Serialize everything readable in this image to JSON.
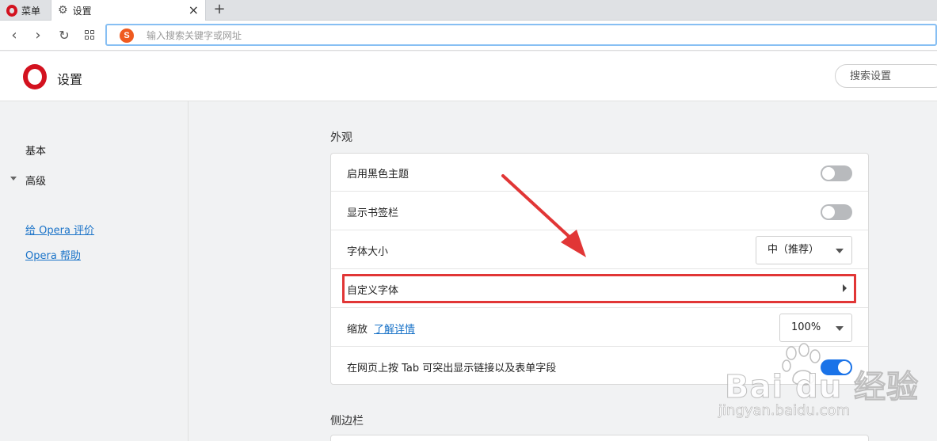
{
  "tabbar": {
    "menu_label": "菜单",
    "tab_title": "设置",
    "close_glyph": "×",
    "new_tab_glyph": "+"
  },
  "navbar": {
    "back_glyph": "‹",
    "forward_glyph": "›",
    "reload_glyph": "↻",
    "search_engine_letter": "S",
    "url_placeholder": "输入搜索关键字或网址",
    "url_value": ""
  },
  "header": {
    "title": "设置",
    "search_placeholder": "搜索设置"
  },
  "sidebar": {
    "basic": "基本",
    "advanced": "高级",
    "rate_link": "给 Opera 评价",
    "help_link": "Opera 帮助"
  },
  "appearance": {
    "section_title": "外观",
    "rows": [
      {
        "label": "启用黑色主题",
        "control": "toggle",
        "on": false
      },
      {
        "label": "显示书签栏",
        "control": "toggle",
        "on": false
      },
      {
        "label": "字体大小",
        "control": "select",
        "value": "中（推荐）"
      },
      {
        "label": "自定义字体",
        "control": "chevron"
      },
      {
        "label": "缩放",
        "link": "了解详情",
        "control": "select",
        "value": "100%"
      },
      {
        "label": "在网页上按 Tab 可突出显示链接以及表单字段",
        "control": "toggle",
        "on": true
      }
    ]
  },
  "sidebar_section": {
    "section_title": "侧边栏"
  },
  "watermark": {
    "brand": "Bai du 经验",
    "url": "jingyan.baidu.com"
  },
  "colors": {
    "accent": "#1a73e8",
    "brand_red": "#d3121f",
    "annotation_red": "#e13636",
    "link": "#1a73c8"
  },
  "icons": [
    "opera-logo-icon",
    "gear-icon",
    "close-icon",
    "plus-icon",
    "back-icon",
    "forward-icon",
    "reload-icon",
    "speed-dial-icon",
    "sogou-search-icon",
    "caret-down-icon",
    "chevron-right-icon"
  ]
}
